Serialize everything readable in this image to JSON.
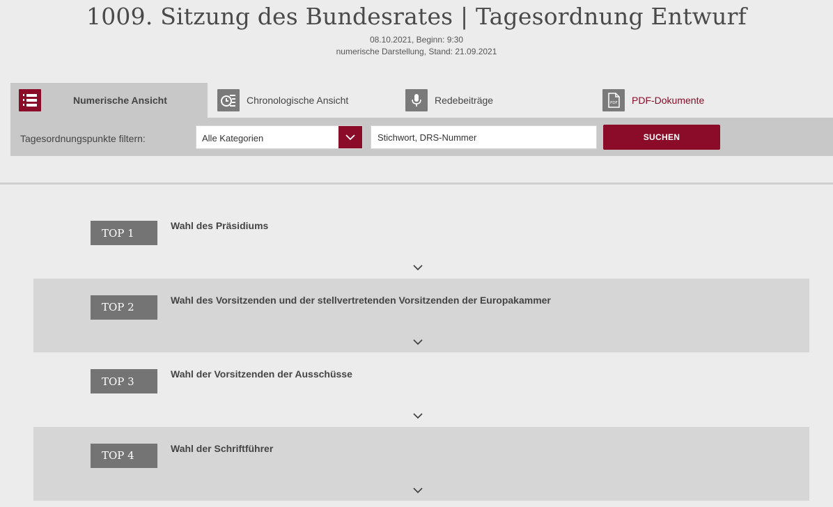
{
  "header": {
    "title": "1009. Sitzung des Bundesrates | Tagesordnung Entwurf",
    "date_line": "08.10.2021, Beginn: 9:30",
    "status_line": "numerische Darstellung, Stand: 21.09.2021"
  },
  "tabs": [
    {
      "label": "Numerische Ansicht",
      "icon": "numbered-list-icon",
      "active": true
    },
    {
      "label": "Chronologische Ansicht",
      "icon": "clock-list-icon",
      "active": false
    },
    {
      "label": "Redebeiträge",
      "icon": "microphone-icon",
      "active": false
    },
    {
      "label": "PDF-Dokumente",
      "icon": "pdf-icon",
      "active": false
    }
  ],
  "filter": {
    "label": "Tagesordnungspunkte filtern:",
    "category_value": "Alle Kategorien",
    "search_placeholder": "Stichwort, DRS-Nummer",
    "search_button": "SUCHEN"
  },
  "agenda": [
    {
      "top": "TOP 1",
      "title": "Wahl des Präsidiums"
    },
    {
      "top": "TOP 2",
      "title": "Wahl des Vorsitzenden und der stellvertretenden Vorsitzenden der Europakammer"
    },
    {
      "top": "TOP 3",
      "title": "Wahl der Vorsitzenden der Ausschüsse"
    },
    {
      "top": "TOP 4",
      "title": "Wahl der Schriftführer"
    }
  ],
  "colors": {
    "accent": "#8a0c28",
    "badge": "#747474",
    "background": "#ececec",
    "shaded_row": "#d6d6d6"
  }
}
